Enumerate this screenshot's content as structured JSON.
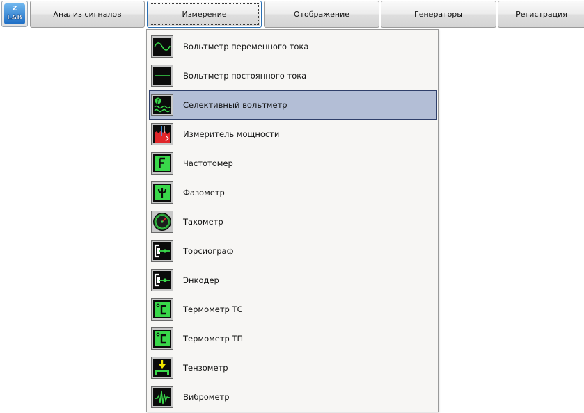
{
  "logo": {
    "text": "LAB",
    "letter": "Z",
    "icon": "zlab-logo-icon"
  },
  "toolbar": {
    "buttons": [
      {
        "label": "Анализ сигналов",
        "active": false
      },
      {
        "label": "Измерение",
        "active": true
      },
      {
        "label": "Отображение",
        "active": false
      },
      {
        "label": "Генераторы",
        "active": false
      },
      {
        "label": "Регистрация",
        "active": false
      }
    ]
  },
  "menu": {
    "items": [
      {
        "label": "Вольтметр переменного тока",
        "icon": "ac-voltmeter-icon",
        "selected": false
      },
      {
        "label": "Вольтметр постоянного тока",
        "icon": "dc-voltmeter-icon",
        "selected": false
      },
      {
        "label": "Селективный вольтметр",
        "icon": "selective-voltmeter-icon",
        "selected": true
      },
      {
        "label": "Измеритель мощности",
        "icon": "power-meter-icon",
        "selected": false
      },
      {
        "label": "Частотомер",
        "icon": "frequency-meter-icon",
        "selected": false
      },
      {
        "label": "Фазометр",
        "icon": "phase-meter-icon",
        "selected": false
      },
      {
        "label": "Тахометр",
        "icon": "tachometer-icon",
        "selected": false
      },
      {
        "label": "Торсиограф",
        "icon": "torsiograph-icon",
        "selected": false
      },
      {
        "label": "Энкодер",
        "icon": "encoder-icon",
        "selected": false
      },
      {
        "label": "Термометр ТС",
        "icon": "thermometer-ts-icon",
        "selected": false
      },
      {
        "label": "Термометр ТП",
        "icon": "thermometer-tp-icon",
        "selected": false
      },
      {
        "label": "Тензометр",
        "icon": "strain-gauge-icon",
        "selected": false
      },
      {
        "label": "Виброметр",
        "icon": "vibrometer-icon",
        "selected": false
      }
    ]
  },
  "colors": {
    "selection_bg": "#b3bed6",
    "selection_border": "#2f3f6a",
    "icon_green": "#39d84a",
    "menu_bg": "#f7f6f4",
    "active_border": "#2a6fb3"
  }
}
